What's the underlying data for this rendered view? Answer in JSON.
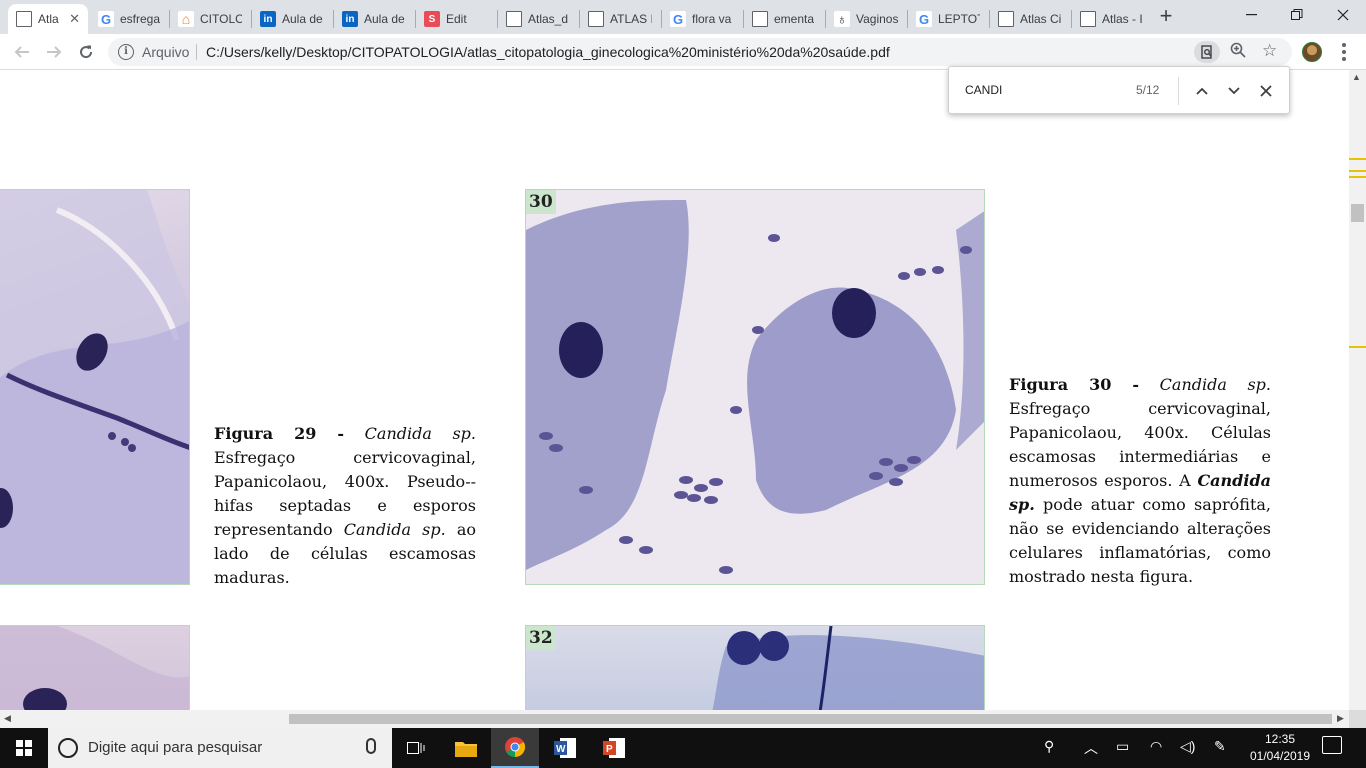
{
  "tabs": [
    {
      "title": "Atla",
      "icon": "pdf-doc-icon",
      "active": true
    },
    {
      "title": "esfrega",
      "icon": "google-icon"
    },
    {
      "title": "CITOLO",
      "icon": "stackoverflow-icon"
    },
    {
      "title": "Aula de",
      "icon": "linkedin-icon"
    },
    {
      "title": "Aula de",
      "icon": "linkedin-icon"
    },
    {
      "title": "Edit",
      "icon": "s-icon"
    },
    {
      "title": "Atlas_d",
      "icon": "doc-icon"
    },
    {
      "title": "ATLAS I",
      "icon": "doc-icon"
    },
    {
      "title": "flora va",
      "icon": "google-icon"
    },
    {
      "title": "ementa",
      "icon": "doc-icon"
    },
    {
      "title": "Vaginos",
      "icon": "drop-icon"
    },
    {
      "title": "LEPTOT",
      "icon": "google-icon"
    },
    {
      "title": "Atlas Ci",
      "icon": "doc-icon"
    },
    {
      "title": "Atlas - I",
      "icon": "doc-icon"
    }
  ],
  "address": {
    "scheme_label": "Arquivo",
    "url": "C:/Users/kelly/Desktop/CITOPATOLOGIA/atlas_citopatologia_ginecologica%20ministério%20da%20saúde.pdf"
  },
  "find": {
    "query": "CANDI",
    "count": "5/12"
  },
  "figures": {
    "fig30_number": "30",
    "fig32_number": "32"
  },
  "captions": {
    "fig29": {
      "label": "Figura 29 -",
      "species": "Candida sp.",
      "text_a": "Esfregaço cervicovaginal, Papanicolaou, 400x. Pseudo--hifas septadas e esporos representando",
      "species2": "Candida sp.",
      "text_b": "ao lado de células escamosas maduras."
    },
    "fig30": {
      "label": "Figura 30 -",
      "species": "Candida sp.",
      "text_a": "Esfregaço cervicovaginal, Papanicolaou, 400x. Células escamosas intermediárias e numerosos esporos. A",
      "species2": "Candida sp.",
      "text_b": "pode atuar como saprófita, não se evidenciando alterações celulares inflamatórias, como mostrado nesta figura."
    }
  },
  "taskbar": {
    "search_placeholder": "Digite aqui para pesquisar",
    "time": "12:35",
    "date": "01/04/2019"
  }
}
